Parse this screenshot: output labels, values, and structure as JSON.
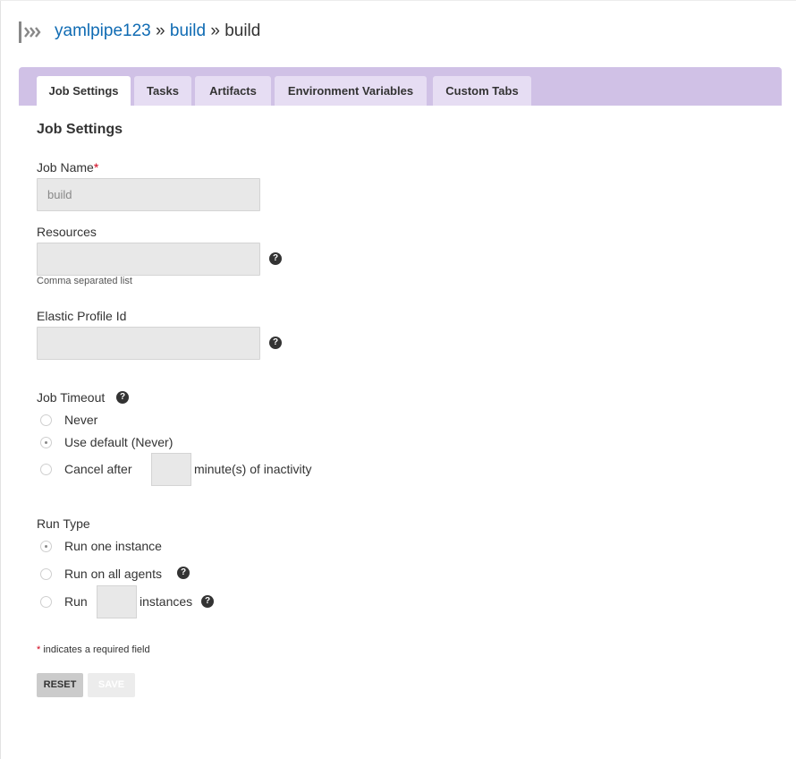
{
  "breadcrumb": {
    "pipeline": "yamlpipe123",
    "sep1": "»",
    "stage": "build",
    "sep2": "»",
    "job": "build"
  },
  "tabs": [
    {
      "label": "Job Settings",
      "active": true
    },
    {
      "label": "Tasks",
      "active": false
    },
    {
      "label": "Artifacts",
      "active": false
    },
    {
      "label": "Environment Variables",
      "active": false
    },
    {
      "label": "Custom Tabs",
      "active": false
    }
  ],
  "form": {
    "title": "Job Settings",
    "job_name": {
      "label": "Job Name",
      "required_mark": "*",
      "value": "build"
    },
    "resources": {
      "label": "Resources",
      "value": "",
      "hint": "Comma separated list"
    },
    "elastic_profile": {
      "label": "Elastic Profile Id",
      "value": ""
    },
    "job_timeout": {
      "label": "Job Timeout",
      "options": [
        "Never",
        "Use default (Never)",
        "Cancel after"
      ],
      "selected": "Use default (Never)",
      "suffix": "minute(s) of inactivity",
      "minutes_value": ""
    },
    "run_type": {
      "label": "Run Type",
      "options": [
        "Run one instance",
        "Run on all agents",
        "Run"
      ],
      "selected": "Run one instance",
      "instances_suffix": "instances",
      "instances_value": ""
    },
    "footnote_mark": "*",
    "footnote": "indicates a required field",
    "reset_label": "RESET",
    "save_label": "SAVE"
  },
  "icons": {
    "help": "question-circle-icon",
    "logo": "gocd-chevrons-icon"
  },
  "colors": {
    "link": "#0f6bb3",
    "tabbar": "#d0c1e6",
    "tab": "#e6ddf3",
    "required": "#d0021b"
  }
}
